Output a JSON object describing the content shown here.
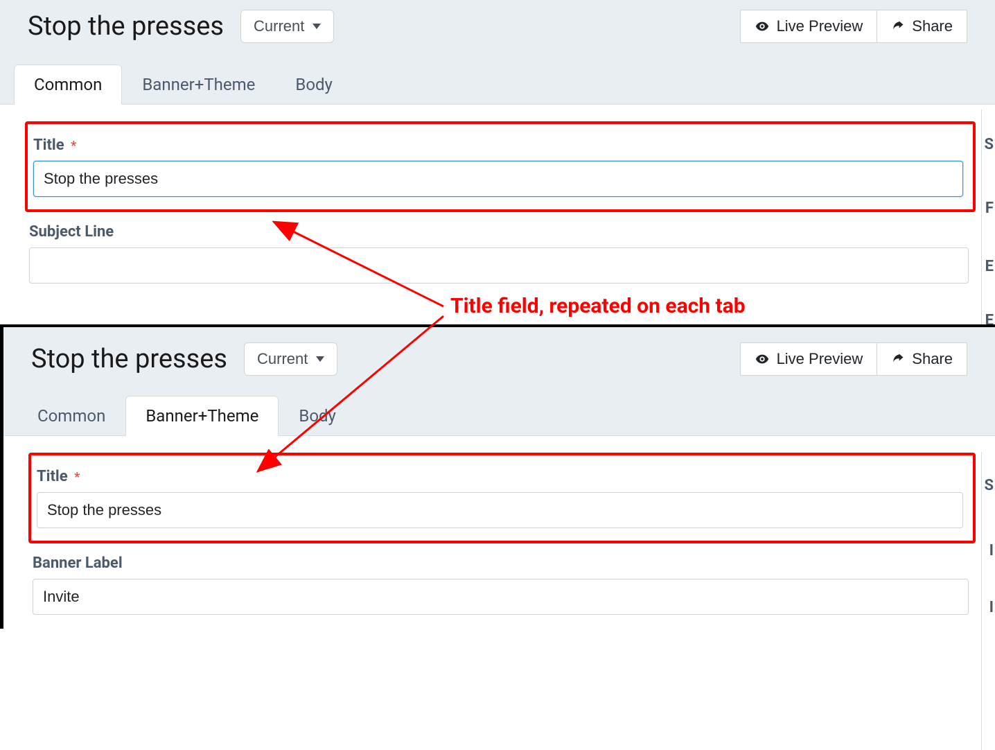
{
  "page_title": "Stop the presses",
  "dropdown_label": "Current",
  "actions": {
    "live_preview": "Live Preview",
    "share": "Share"
  },
  "tabs": {
    "common": "Common",
    "banner_theme": "Banner+Theme",
    "body": "Body"
  },
  "top_panel": {
    "active_tab": "common",
    "fields": {
      "title_label": "Title",
      "title_value": "Stop the presses",
      "subject_label": "Subject Line",
      "subject_value": ""
    }
  },
  "bottom_panel": {
    "active_tab": "banner_theme",
    "fields": {
      "title_label": "Title",
      "title_value": "Stop the presses",
      "banner_label_label": "Banner Label",
      "banner_label_value": "Invite"
    }
  },
  "annotation_text": "Title field, repeated on each tab",
  "sidebar_letters_top": [
    "S",
    "F",
    "E",
    "E"
  ],
  "sidebar_letters_bottom": [
    "S",
    "I",
    "I"
  ]
}
